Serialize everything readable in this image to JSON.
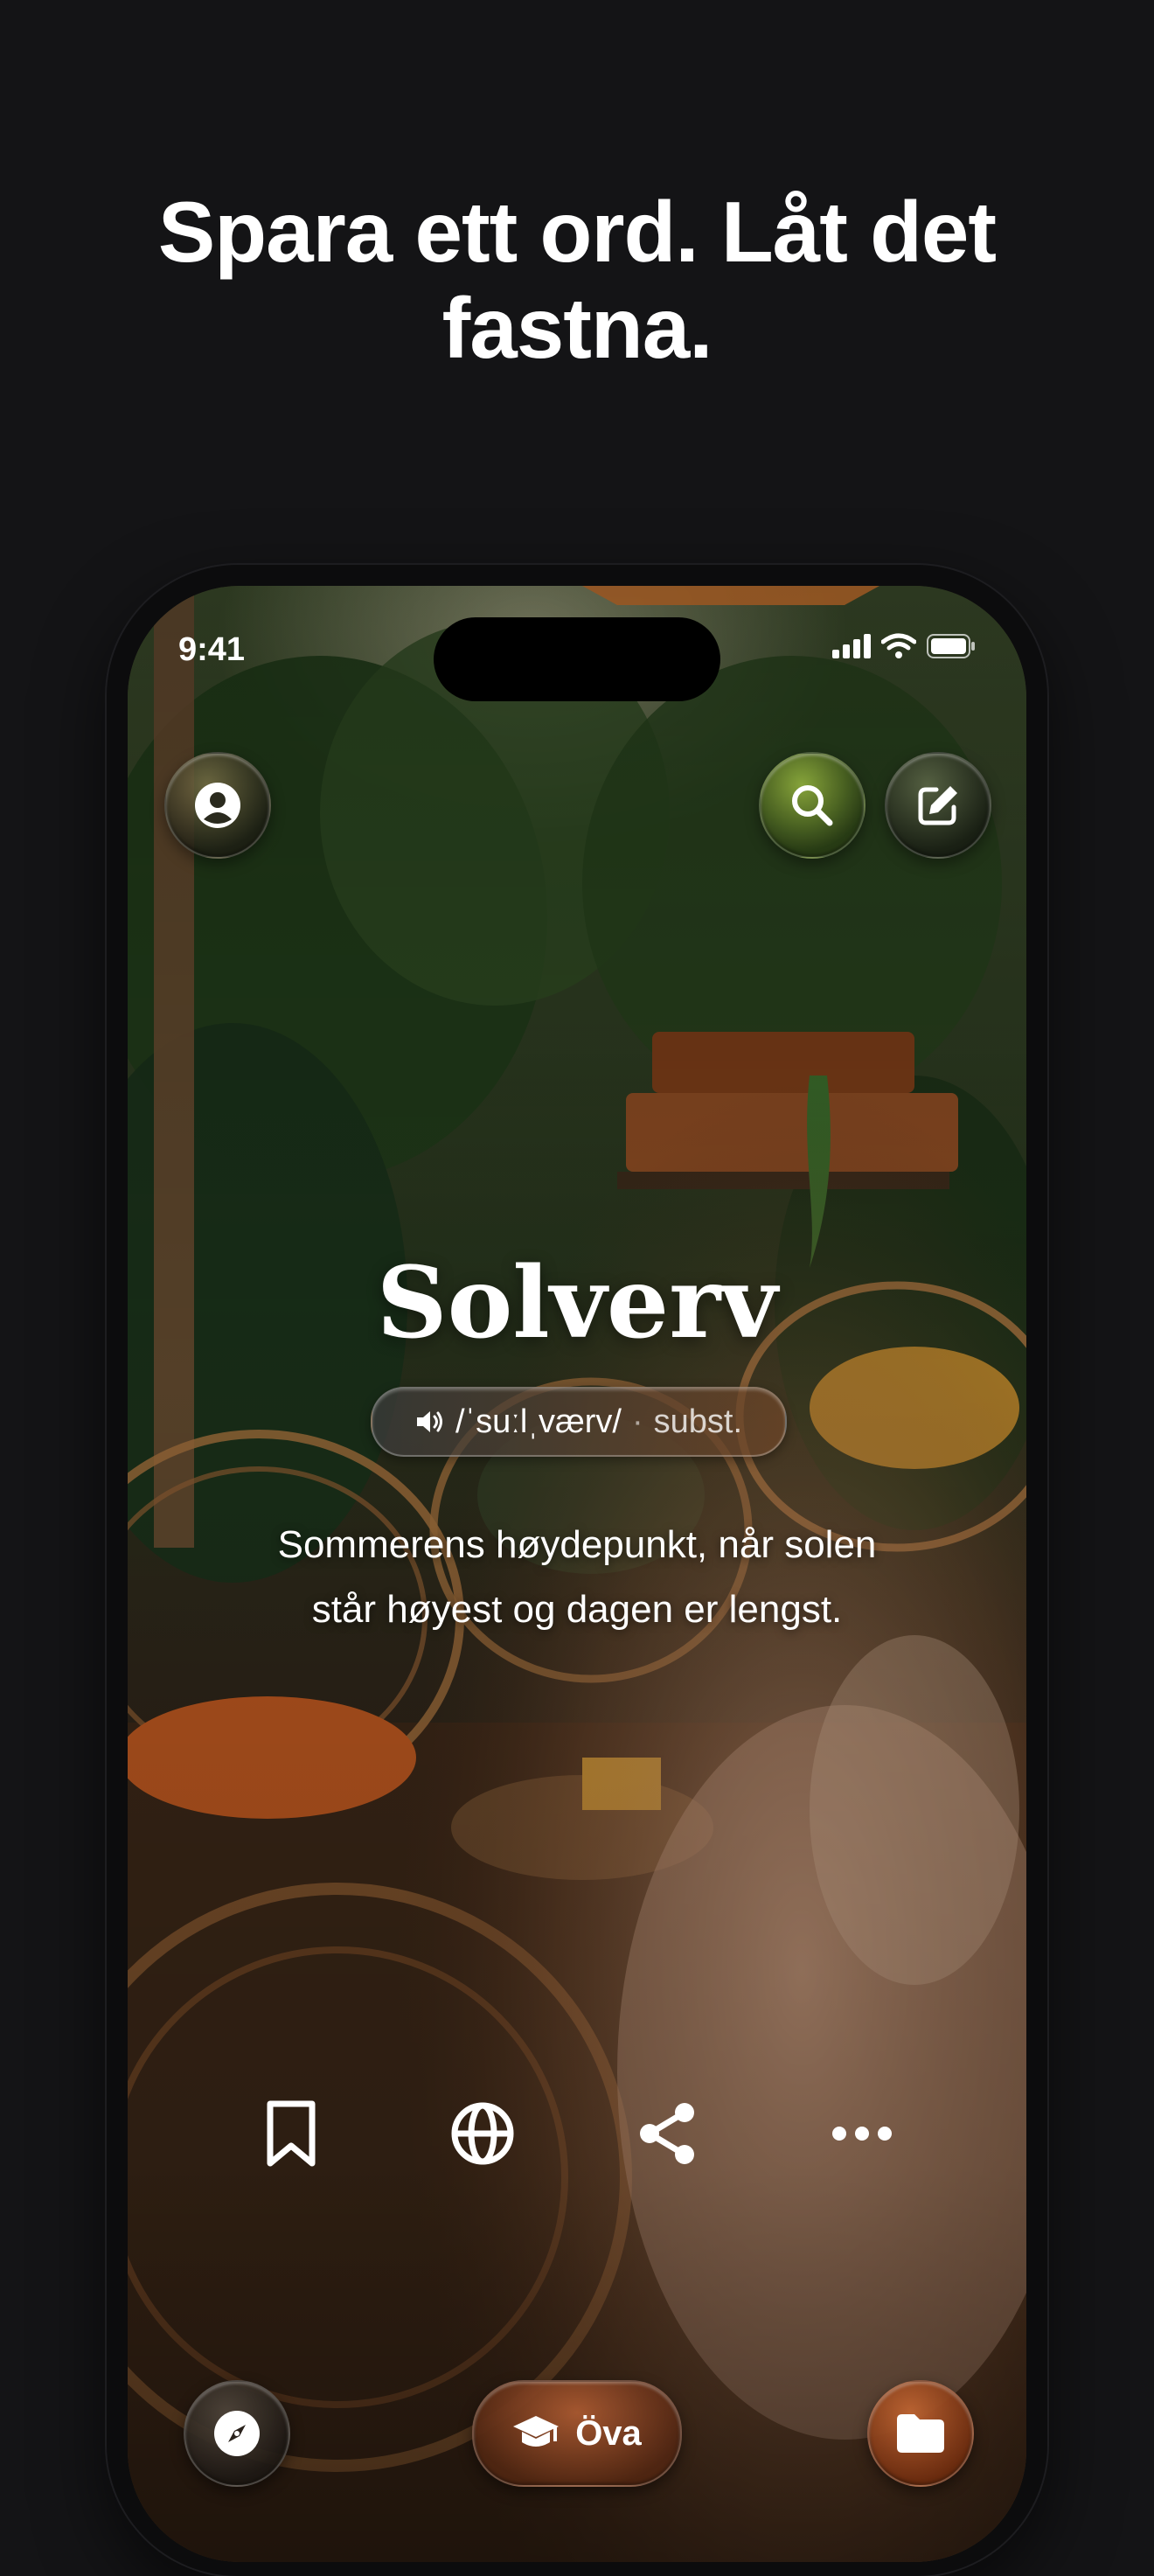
{
  "headline": {
    "line1": "Spara ett ord. Låt det",
    "line2": "fastna."
  },
  "status_bar": {
    "time": "9:41",
    "icons": [
      "signal-icon",
      "wifi-icon",
      "battery-icon"
    ]
  },
  "top_bar": {
    "left": "profile-icon",
    "right": [
      "search-icon",
      "compose-icon"
    ]
  },
  "word": {
    "title": "Solverv",
    "pronunciation": "/ˈsuːlˌværv/",
    "separator": "·",
    "part_of_speech": "subst.",
    "definition_line1": "Sommerens høydepunkt, når solen",
    "definition_line2": "står høyest og dagen er lengst."
  },
  "actions": [
    "bookmark-icon",
    "translate-globe-icon",
    "share-icon",
    "more-icon"
  ],
  "bottom_bar": {
    "practice_label": "Öva",
    "left_icon": "compass-icon",
    "right_icon": "folder-icon"
  },
  "colors": {
    "page_background": "#141416",
    "practice_button": "#8a4a26",
    "folder_button": "#9a4a1c",
    "search_button": "#6f8a2e"
  }
}
